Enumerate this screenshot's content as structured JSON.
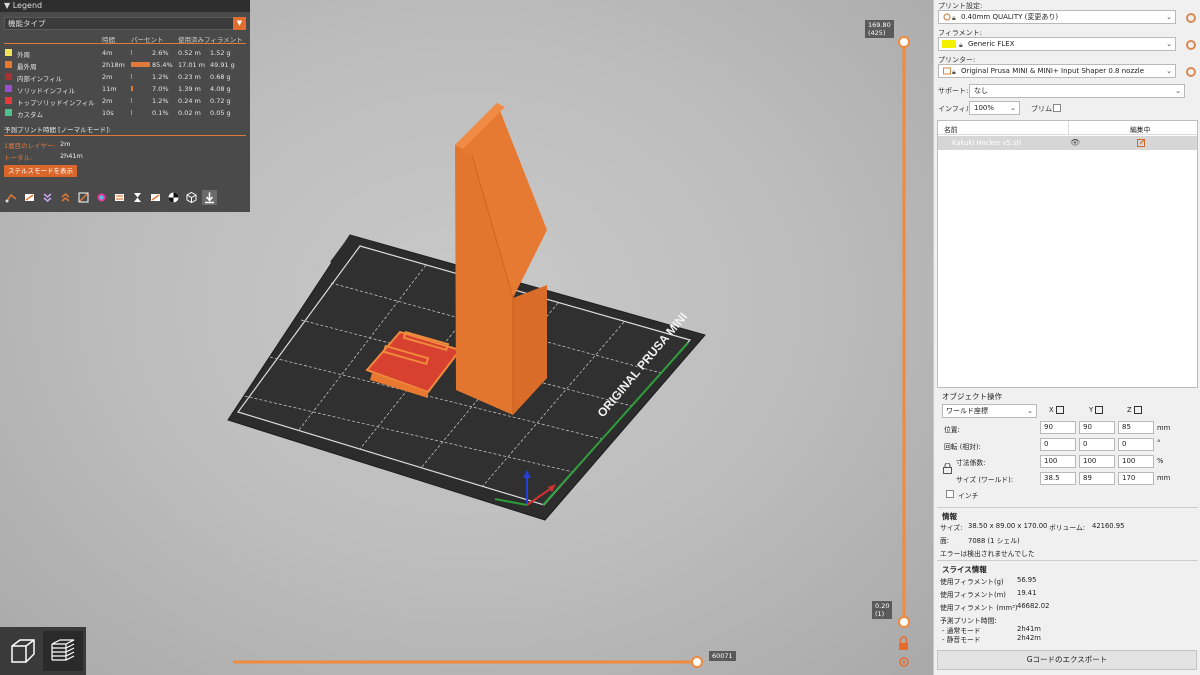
{
  "colors": {
    "accent": "#e06c2e",
    "model_orange": "#e8782f",
    "bed_dark": "#2e2e2e",
    "legend_bg": "#4a4a4a",
    "slider_orange": "#f08a3c"
  },
  "legend": {
    "title": "Legend",
    "view_type": "機能タイプ",
    "columns": {
      "time": "時間",
      "percent": "パーセント",
      "filament": "使用済みフィラメント"
    },
    "rows": [
      {
        "name": "外周",
        "color": "#f3e35a",
        "time": "4m",
        "percent": "2.6%",
        "meters": "0.52 m",
        "grams": "1.52 g",
        "fraction": 0.026
      },
      {
        "name": "最外周",
        "color": "#e8782f",
        "time": "2h18m",
        "percent": "85.4%",
        "meters": "17.01 m",
        "grams": "49.91 g",
        "fraction": 0.854
      },
      {
        "name": "内部インフィル",
        "color": "#a83232",
        "time": "2m",
        "percent": "1.2%",
        "meters": "0.23 m",
        "grams": "0.68 g",
        "fraction": 0.012
      },
      {
        "name": "ソリッドインフィル",
        "color": "#9a4fd0",
        "time": "11m",
        "percent": "7.0%",
        "meters": "1.39 m",
        "grams": "4.08 g",
        "fraction": 0.07
      },
      {
        "name": "トップソリッドインフィル",
        "color": "#e83a3a",
        "time": "2m",
        "percent": "1.2%",
        "meters": "0.24 m",
        "grams": "0.72 g",
        "fraction": 0.012
      },
      {
        "name": "カスタム",
        "color": "#4fc18a",
        "time": "10s",
        "percent": "0.1%",
        "meters": "0.02 m",
        "grams": "0.05 g",
        "fraction": 0.001
      }
    ],
    "estimate_title": "予測プリント時間 [ノーマルモード]:",
    "first_layer_label": "1層目のレイヤー:",
    "first_layer_value": "2m",
    "total_label": "トータル:",
    "total_value": "2h41m",
    "stealth_button": "ステルスモードを表示",
    "tools": [
      "travel-icon",
      "wipe-icon",
      "retractions-icon",
      "deretractions-icon",
      "seams-icon",
      "tool-changes-icon",
      "color-changes-icon",
      "pause-icon",
      "custom-gcode-icon",
      "center-of-gravity-icon",
      "shells-icon",
      "tool-marker-icon"
    ]
  },
  "vertical_slider": {
    "top_value": "169.80",
    "top_layer": "(425)",
    "bottom_value": "0.20",
    "bottom_layer": "(1)"
  },
  "horizontal_slider": {
    "value": "60071"
  },
  "bed": {
    "label": "ORIGINAL PRUSA MINI"
  },
  "panel": {
    "print_settings_label": "プリント設定:",
    "print_settings_value": "0.40mm QUALITY (変更あり)",
    "filament_label": "フィラメント:",
    "filament_value": "Generic FLEX",
    "filament_color": "#f2f200",
    "printer_label": "プリンター:",
    "printer_value": "Original Prusa MINI & MINI+ Input Shaper 0.8 nozzle",
    "support_label": "サポート:",
    "support_value": "なし",
    "infill_label": "インフィル:",
    "infill_value": "100%",
    "brim_label": "ブリム:",
    "list_header_name": "名前",
    "list_header_edit": "編集中",
    "object_name": "Kakuki Hacker v5.stl",
    "object_ops_title": "オブジェクト操作",
    "coord_system": "ワールド座標",
    "axis_x": "X",
    "axis_y": "Y",
    "axis_z": "Z",
    "position_label": "位置:",
    "position": [
      "90",
      "90",
      "85"
    ],
    "position_unit": "mm",
    "rotation_label": "回転 (相対):",
    "rotation": [
      "0",
      "0",
      "0"
    ],
    "rotation_unit": "°",
    "scale_label": "寸法係数:",
    "scale": [
      "100",
      "100",
      "100"
    ],
    "scale_unit": "%",
    "size_label": "サイズ (ワールド):",
    "size": [
      "38.5",
      "89",
      "170"
    ],
    "size_unit": "mm",
    "inch_label": "インチ",
    "info_title": "情報",
    "info_size_label": "サイズ:",
    "info_size_value": "38.50 x 89.00 x 170.00",
    "info_volume_label": "ボリューム:",
    "info_volume_value": "42160.95",
    "info_faces_label": "面:",
    "info_faces_value": "7088 (1 シェル)",
    "info_errors": "エラーは検出されませんでした",
    "slice_title": "スライス情報",
    "slice_rows": [
      {
        "label": "使用フィラメント(g)",
        "value": "56.95"
      },
      {
        "label": "使用フィラメント(m)",
        "value": "19.41"
      },
      {
        "label": "使用フィラメント (mm³)",
        "value": "46682.02"
      }
    ],
    "est_time_label": "予測プリント時間:",
    "normal_mode_label": "- 通常モード",
    "normal_mode_value": "2h41m",
    "silent_mode_label": "- 静音モード",
    "silent_mode_value": "2h42m",
    "export_button": "Gコードのエクスポート"
  }
}
